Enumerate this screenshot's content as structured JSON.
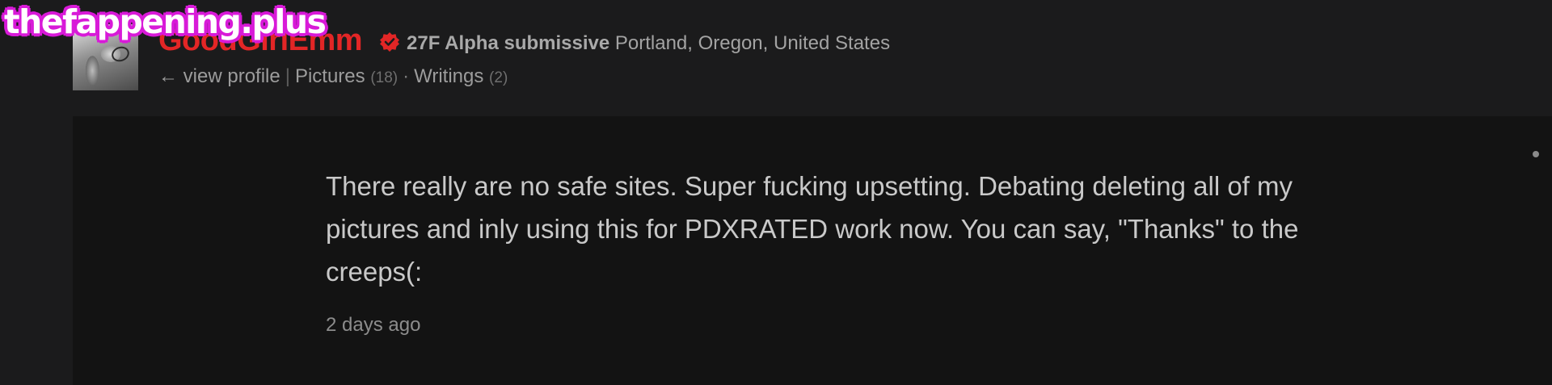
{
  "watermark": {
    "text": "thefappening.plus"
  },
  "profile": {
    "username": "GoodGirlEmm",
    "verified_icon": "verified-badge-icon",
    "tags": "27F Alpha submissive",
    "location": "Portland, Oregon, United States",
    "view_profile": "← view profile",
    "separator": "|",
    "pictures_label": "Pictures",
    "pictures_count": "(18)",
    "dot": "·",
    "writings_label": "Writings",
    "writings_count": "(2)"
  },
  "post": {
    "text": "There really are no safe sites. Super fucking upsetting. Debating deleting all of my pictures and inly using this for PDXRATED work now. You can say, \"Thanks\" to the creeps(:",
    "time": "2 days ago"
  },
  "colors": {
    "username": "#e32626",
    "verified": "#e32626",
    "watermark_outline": "#d81ad8"
  }
}
